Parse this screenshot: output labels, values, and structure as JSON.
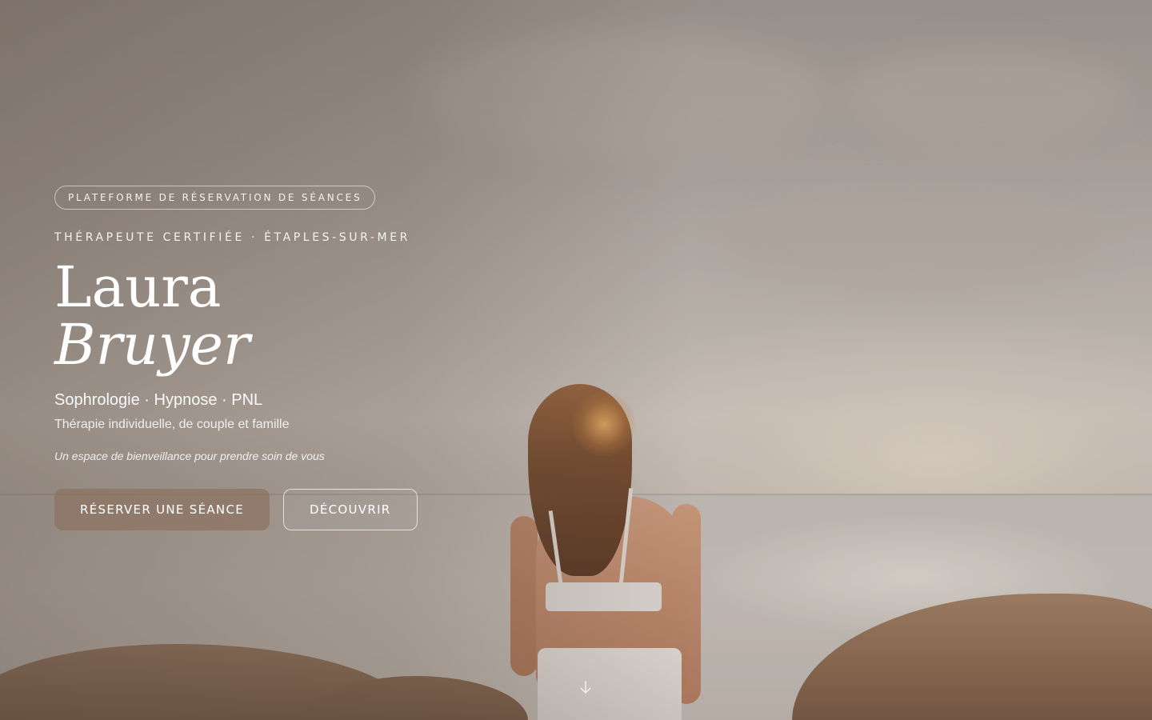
{
  "hero": {
    "badge": "PLATEFORME DE RÉSERVATION DE SÉANCES",
    "subtitle": "THÉRAPEUTE CERTIFIÉE · ÉTAPLES-SUR-MER",
    "first_name": "Laura",
    "last_name": "Bruyer",
    "disciplines": "Sophrologie · Hypnose · PNL",
    "therapies": "Thérapie individuelle, de couple et famille",
    "tagline": "Un espace de bienveillance pour prendre soin de vous",
    "primary_button": "RÉSERVER UNE SÉANCE",
    "secondary_button": "DÉCOUVRIR",
    "scroll_icon": "arrow-down-icon"
  },
  "colors": {
    "primary_button_bg": "#8c7362",
    "text": "#ffffff"
  }
}
